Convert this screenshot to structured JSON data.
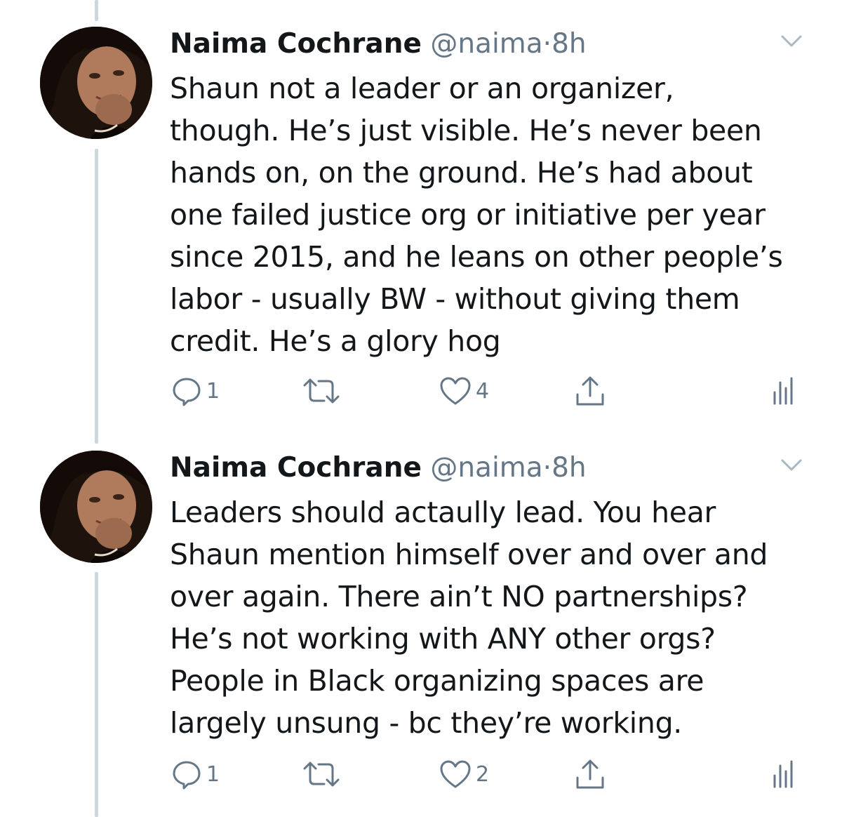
{
  "tweets": [
    {
      "author_name": "Naima Cochrane",
      "handle": "@naima",
      "separator": "·",
      "time": "8h",
      "text": "Shaun not a leader or an organizer,\nthough. He’s just visible. He’s never been\nhands on, on the ground. He’s had about\none failed justice org or initiative per year\nsince 2015, and he leans on other people’s\nlabor - usually BW - without giving them\ncredit. He’s a glory hog",
      "reply_count": "1",
      "retweet_count": "",
      "like_count": "4"
    },
    {
      "author_name": "Naima Cochrane",
      "handle": "@naima",
      "separator": "·",
      "time": "8h",
      "text": "Leaders should actaully lead. You hear\nShaun mention himself over and over and\nover again. There ain’t NO partnerships?\nHe’s not working with ANY other orgs?\nPeople in Black organizing spaces are\nlargely unsung - bc they’re working.",
      "reply_count": "1",
      "retweet_count": "",
      "like_count": "2"
    }
  ],
  "icons": {
    "reply": "reply-icon",
    "retweet": "retweet-icon",
    "like": "heart-icon",
    "share": "share-icon",
    "analytics": "analytics-icon",
    "caret": "chevron-down-icon"
  },
  "colors": {
    "text": "#14171a",
    "secondary": "#657786",
    "thread_line": "#ccd6dd",
    "caret": "#aab8c2"
  }
}
